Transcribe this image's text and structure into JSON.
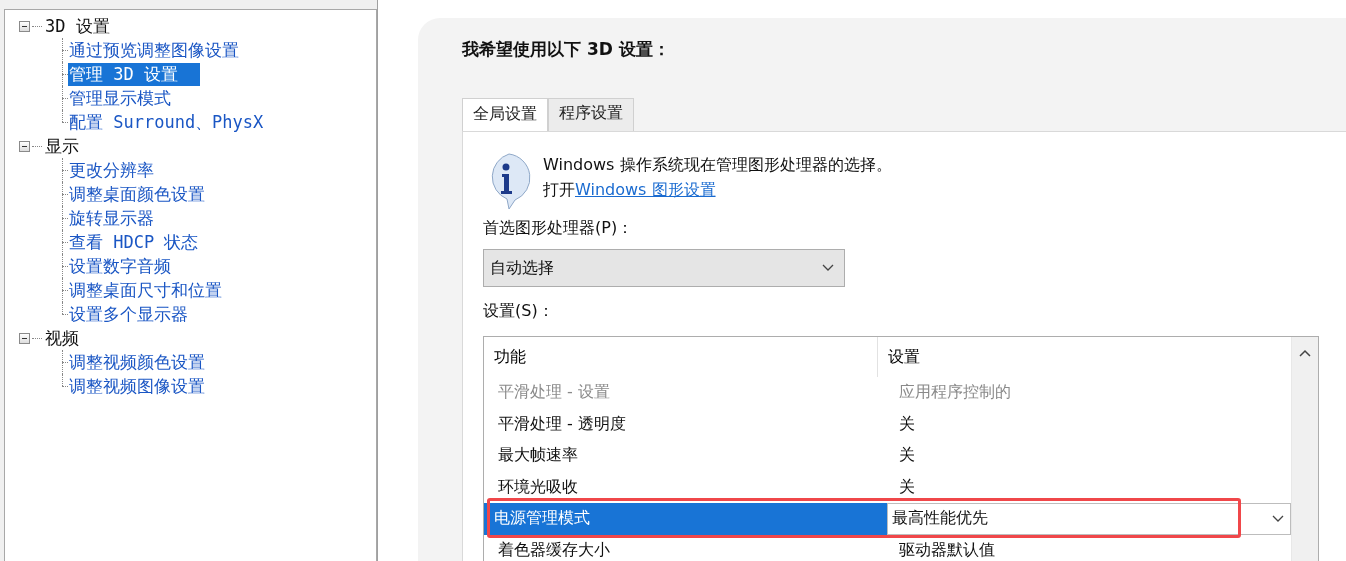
{
  "sidebar": {
    "tree": [
      {
        "label": "3D 设置",
        "expanded": true,
        "children": [
          {
            "label": "通过预览调整图像设置",
            "selected": false
          },
          {
            "label": "管理 3D 设置",
            "selected": true
          },
          {
            "label": "管理显示模式",
            "selected": false
          },
          {
            "label": "配置 Surround、PhysX",
            "selected": false
          }
        ]
      },
      {
        "label": "显示",
        "expanded": true,
        "children": [
          {
            "label": "更改分辨率",
            "selected": false
          },
          {
            "label": "调整桌面颜色设置",
            "selected": false
          },
          {
            "label": "旋转显示器",
            "selected": false
          },
          {
            "label": "查看 HDCP 状态",
            "selected": false
          },
          {
            "label": "设置数字音频",
            "selected": false
          },
          {
            "label": "调整桌面尺寸和位置",
            "selected": false
          },
          {
            "label": "设置多个显示器",
            "selected": false
          }
        ]
      },
      {
        "label": "视频",
        "expanded": true,
        "children": [
          {
            "label": "调整视频颜色设置",
            "selected": false
          },
          {
            "label": "调整视频图像设置",
            "selected": false
          }
        ]
      }
    ]
  },
  "main": {
    "title": "我希望使用以下 3D 设置：",
    "tabs": [
      {
        "label": "全局设置",
        "selected": true
      },
      {
        "label": "程序设置",
        "selected": false
      }
    ],
    "info": {
      "message": "Windows 操作系统现在管理图形处理器的选择。",
      "prefix": "打开",
      "link": "Windows 图形设置"
    },
    "gpu_label": "首选图形处理器(P)：",
    "gpu_dropdown": {
      "value": "自动选择"
    },
    "settings_label": "设置(S)：",
    "table": {
      "columns": [
        "功能",
        "设置"
      ],
      "rows": [
        {
          "feature": "平滑处理 - 设置",
          "value": "应用程序控制的",
          "disabled": true,
          "selected": false,
          "highlighted": false
        },
        {
          "feature": "平滑处理 - 透明度",
          "value": "关",
          "disabled": false,
          "selected": false,
          "highlighted": false
        },
        {
          "feature": "最大帧速率",
          "value": "关",
          "disabled": false,
          "selected": false,
          "highlighted": false
        },
        {
          "feature": "环境光吸收",
          "value": "关",
          "disabled": false,
          "selected": false,
          "highlighted": false
        },
        {
          "feature": "电源管理模式",
          "value": "最高性能优先",
          "disabled": false,
          "selected": true,
          "highlighted": true
        },
        {
          "feature": "着色器缓存大小",
          "value": "驱动器默认值",
          "disabled": false,
          "selected": false,
          "highlighted": false
        }
      ]
    }
  }
}
